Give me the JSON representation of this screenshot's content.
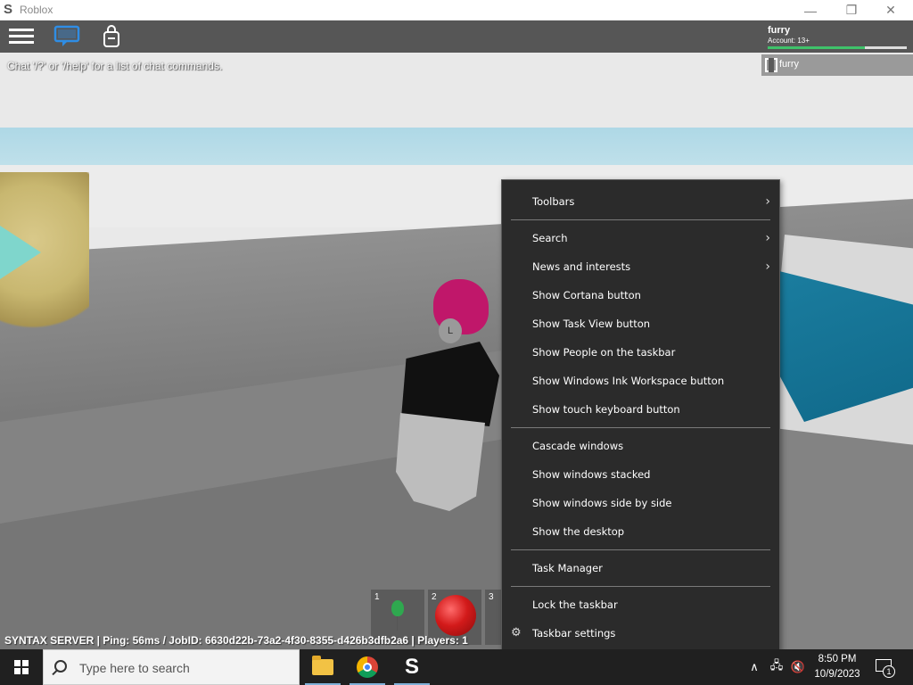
{
  "window": {
    "title": "Roblox",
    "app_icon": "S",
    "buttons": {
      "minimize": "—",
      "maximize": "❐",
      "close": "✕"
    }
  },
  "game": {
    "chat_hint": "Chat '/?' or '/help' for a list of chat commands.",
    "user": {
      "name": "furry",
      "account": "Account: 13+"
    },
    "player_list": [
      "furry"
    ],
    "avatar_face": "L",
    "hotbar": [
      {
        "number": "1",
        "item_icon": "balloon-icon"
      },
      {
        "number": "2",
        "item_icon": "apple-icon"
      },
      {
        "number": "3",
        "item_icon": ""
      }
    ],
    "status_text": "SYNTAX SERVER | Ping: 56ms / JobID: 6630d22b-73a2-4f30-8355-d426b3dfb2a6 | Players: 1"
  },
  "context_menu": {
    "toolbars": "Toolbars",
    "search": "Search",
    "news_and_interests": "News and interests",
    "show_cortana": "Show Cortana button",
    "show_task_view": "Show Task View button",
    "show_people": "Show People on the taskbar",
    "show_ink_workspace": "Show Windows Ink Workspace button",
    "show_touch_keyboard": "Show touch keyboard button",
    "cascade": "Cascade windows",
    "stacked": "Show windows stacked",
    "side_by_side": "Show windows side by side",
    "show_desktop": "Show the desktop",
    "task_manager": "Task Manager",
    "lock_taskbar": "Lock the taskbar",
    "taskbar_settings": "Taskbar settings"
  },
  "taskbar": {
    "search_placeholder": "Type here to search",
    "apps": [
      "file-explorer-icon",
      "chrome-icon",
      "syntax-icon"
    ],
    "syntax_glyph": "S",
    "tray": {
      "chevron": "∧",
      "network": "🖧",
      "volume": "🔇"
    },
    "time": "8:50 PM",
    "date": "10/9/2023",
    "notification_count": "1"
  },
  "colors": {
    "menu_bg": "#2b2b2b",
    "taskbar_bg": "#202020",
    "hair": "#c0176a",
    "water": "#1b7ea0"
  }
}
